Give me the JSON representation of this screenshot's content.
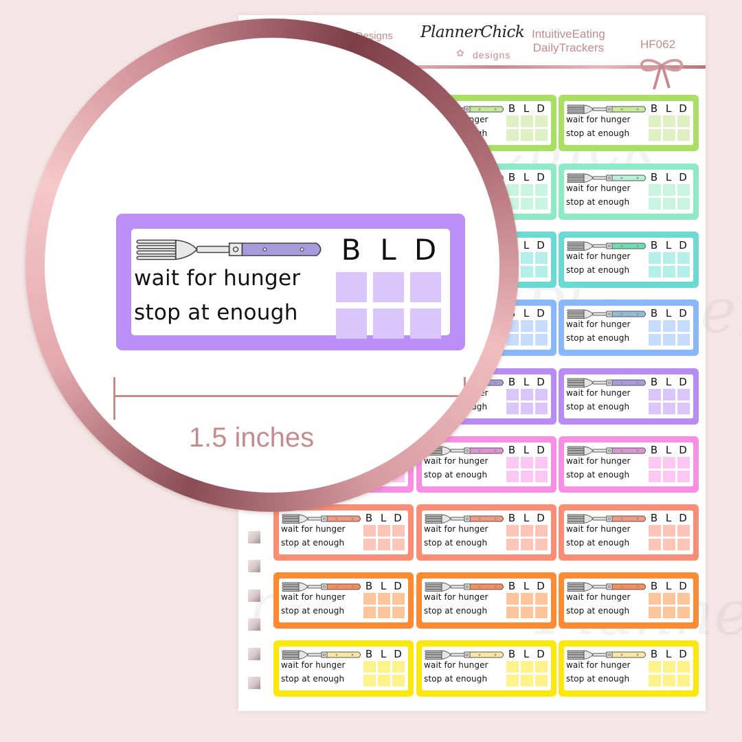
{
  "header": {
    "shop_name": "ChickDesigns",
    "logo_script": "PlannerChick",
    "logo_sub": "designs",
    "title_line1": "IntuitiveEating",
    "title_line2": "DailyTrackers",
    "product_code": "HF062"
  },
  "sticker": {
    "meal_labels": [
      "B",
      "L",
      "D"
    ],
    "line1": "wait for hunger",
    "line2": "stop at enough",
    "icon": "fork-icon"
  },
  "rows": [
    {
      "name": "lime",
      "frame": "#a9e063",
      "box": "#dff1c2",
      "handle": "#c5eb9a"
    },
    {
      "name": "mint",
      "frame": "#8eeac5",
      "box": "#c9f4e2",
      "handle": "#b8f0d8"
    },
    {
      "name": "teal",
      "frame": "#69dbd4",
      "box": "#b4efea",
      "handle": "#71dcb4"
    },
    {
      "name": "blue",
      "frame": "#88b8fb",
      "box": "#c5dcfd",
      "handle": "#8fbcd8"
    },
    {
      "name": "purple",
      "frame": "#b98cf5",
      "box": "#dac6fb",
      "handle": "#a99bdb"
    },
    {
      "name": "pink",
      "frame": "#f88fe5",
      "box": "#fcc8f3",
      "handle": "#e094cf"
    },
    {
      "name": "salmon",
      "frame": "#fa8d74",
      "box": "#fdc4b7",
      "handle": "#f4987f"
    },
    {
      "name": "orange",
      "frame": "#fe8a34",
      "box": "#fec49a",
      "handle": "#f68d5a"
    },
    {
      "name": "yellow",
      "frame": "#fde80e",
      "box": "#fdf38a",
      "handle": "#fbe8a0"
    }
  ],
  "zoom_preview": {
    "frame_color": "#bb8ff7",
    "box_color": "#dac6fb",
    "handle_color": "#a99bdb",
    "measurement_label": "1.5 inches"
  },
  "colors": {
    "background": "#f4e6e6",
    "rose_gold": "#c48c8d"
  }
}
